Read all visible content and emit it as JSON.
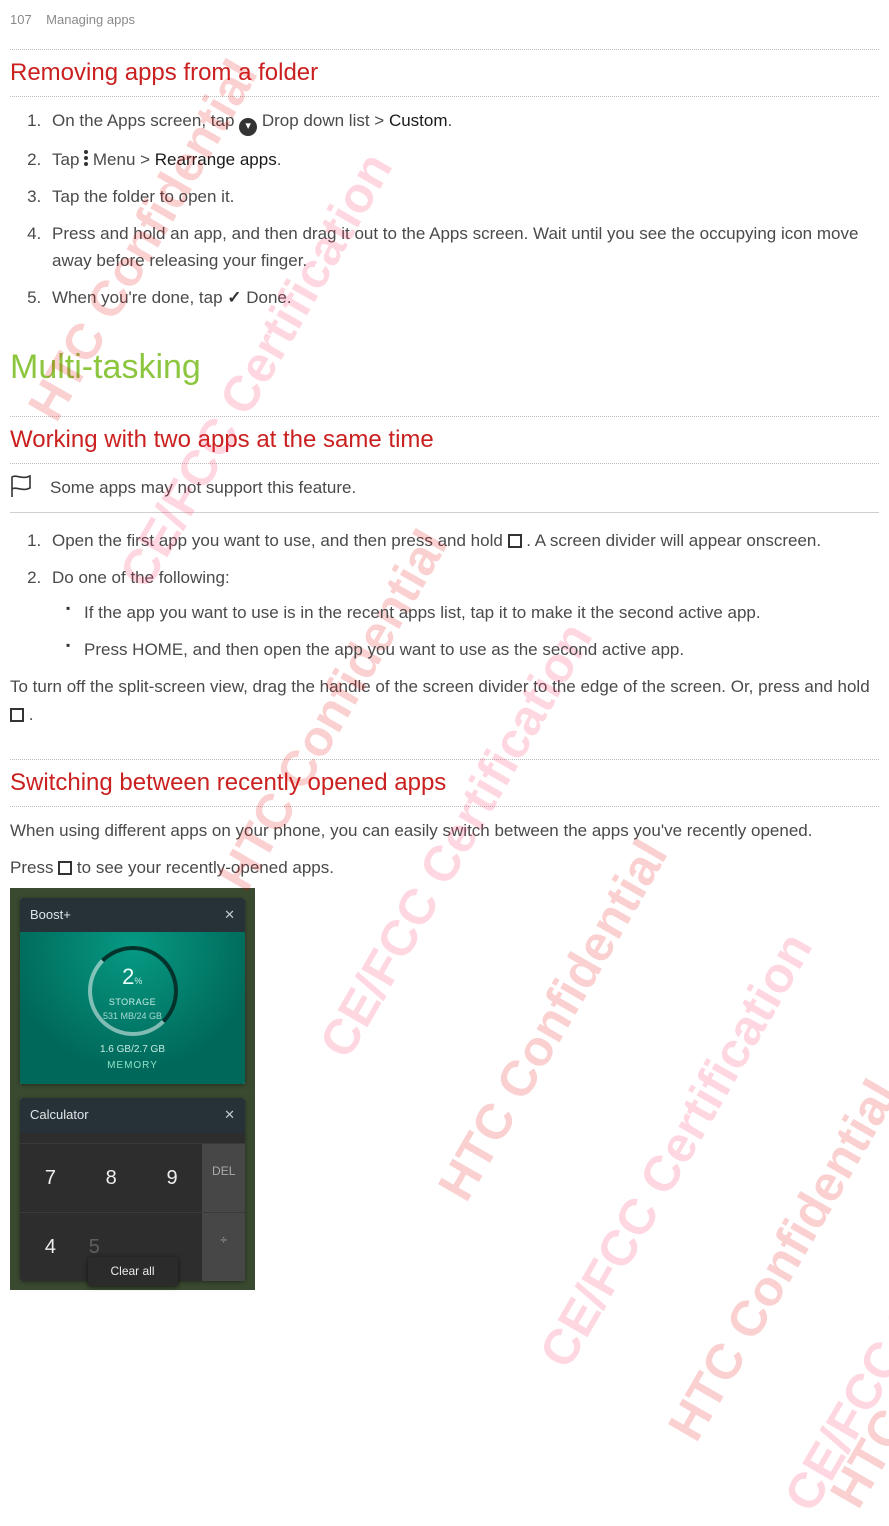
{
  "header": {
    "page_num": "107",
    "chapter": "Managing apps"
  },
  "sec_remove": {
    "title": "Removing apps from a folder",
    "step1a": "On the Apps screen, tap ",
    "step1b": "Drop down list > ",
    "step1c": "Custom",
    "step1d": ".",
    "step2a": "Tap ",
    "step2b": " Menu > ",
    "step2c": "Rearrange apps",
    "step2d": ".",
    "step3": "Tap the folder to open it.",
    "step4": "Press and hold an app, and then drag it out to the Apps screen. Wait until you see the occupying icon move away before releasing your finger.",
    "step5a": "When you're done, tap ",
    "step5b": "Done."
  },
  "sec_multi": {
    "title": "Multi-tasking",
    "two_apps": {
      "title": "Working with two apps at the same time",
      "note": "Some apps may not support this feature.",
      "step1a": "Open the first app you want to use, and then press and hold ",
      "step1b": ". A screen divider will appear onscreen.",
      "step2": "Do one of the following:",
      "b1": "If the app you want to use is in the recent apps list, tap it to make it the second active app.",
      "b2": "Press  HOME, and then open the app you want to use as the second active app.",
      "turnoff_a": "To turn off the split-screen view, drag the handle of the screen divider to the edge of the screen. Or, press and hold ",
      "turnoff_b": "."
    },
    "switch": {
      "title": "Switching between recently opened apps",
      "intro": "When using different apps on your phone, you can easily switch between the apps you've recently opened.",
      "press_a": "Press ",
      "press_b": " to see your recently-opened apps."
    }
  },
  "shot": {
    "card1": {
      "title": "Boost+",
      "pct_num": "2",
      "pct_sym": "%",
      "storage_lbl": "STORAGE",
      "storage_val": "531 MB/24 GB",
      "line2": "1.6 GB/2.7 GB",
      "mem": "MEMORY"
    },
    "card2": {
      "title": "Calculator",
      "disp_blank": " ",
      "disp_num": "5",
      "k7": "7",
      "k8": "8",
      "k9": "9",
      "del": "DEL",
      "k4": "4",
      "div": "÷"
    },
    "clear": "Clear all"
  },
  "wm": {
    "conf": "HTC Confidential",
    "cert": "CE/FCC Certification",
    "conf_short": "HTC Con",
    "cert_short": "CE/FCC Certificati"
  }
}
